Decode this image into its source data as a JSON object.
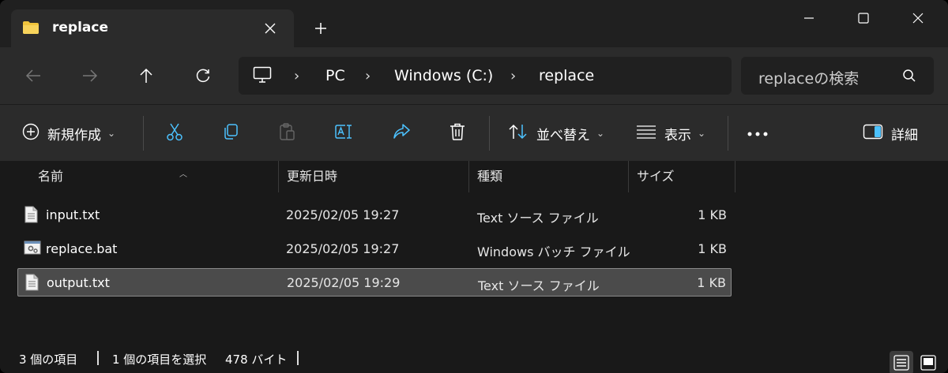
{
  "tab": {
    "title": "replace"
  },
  "address": {
    "crumbs": [
      "PC",
      "Windows (C:)",
      "replace"
    ]
  },
  "search": {
    "placeholder": "replaceの検索"
  },
  "commands": {
    "new": "新規作成",
    "sort": "並べ替え",
    "view": "表示",
    "details": "詳細"
  },
  "columns": {
    "name": "名前",
    "modified": "更新日時",
    "type": "種類",
    "size": "サイズ"
  },
  "files": [
    {
      "name": "input.txt",
      "modified": "2025/02/05 19:27",
      "type": "Text ソース ファイル",
      "size": "1 KB",
      "icon": "text-file-icon"
    },
    {
      "name": "replace.bat",
      "modified": "2025/02/05 19:27",
      "type": "Windows バッチ ファイル",
      "size": "1 KB",
      "icon": "batch-file-icon"
    },
    {
      "name": "output.txt",
      "modified": "2025/02/05 19:29",
      "type": "Text ソース ファイル",
      "size": "1 KB",
      "icon": "text-file-icon",
      "selected": true
    }
  ],
  "status": {
    "count": "3 個の項目",
    "selection": "1 個の項目を選択",
    "bytes": "478 バイト"
  },
  "colors": {
    "accent": "#4cc2ff",
    "selection": "#4b4b4b"
  }
}
